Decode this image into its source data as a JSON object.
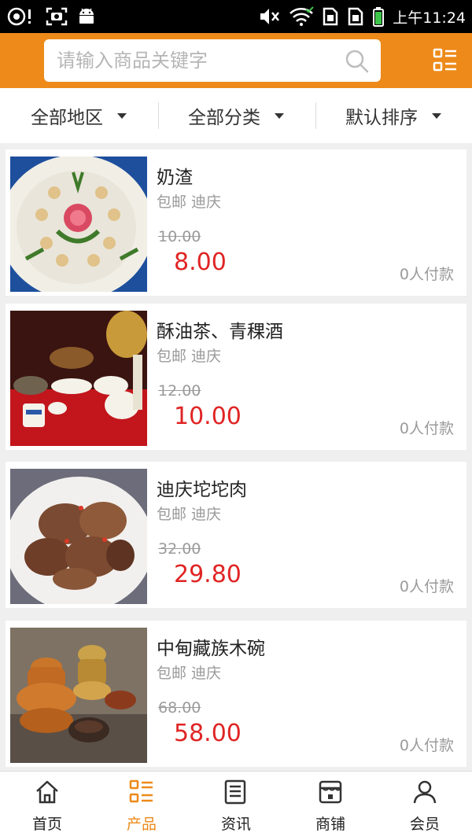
{
  "status_bar": {
    "time": "上午11:24"
  },
  "header": {
    "search_placeholder": "请输入商品关键字",
    "accent_color": "#ed8a19"
  },
  "filters": [
    {
      "label": "全部地区"
    },
    {
      "label": "全部分类"
    },
    {
      "label": "默认排序"
    }
  ],
  "products": [
    {
      "name": "奶渣",
      "tags": "包邮 迪庆",
      "original_price": "10.00",
      "price": "8.00",
      "sold": "0人付款"
    },
    {
      "name": "酥油茶、青稞酒",
      "tags": "包邮 迪庆",
      "original_price": "12.00",
      "price": "10.00",
      "sold": "0人付款"
    },
    {
      "name": "迪庆坨坨肉",
      "tags": "包邮 迪庆",
      "original_price": "32.00",
      "price": "29.80",
      "sold": "0人付款"
    },
    {
      "name": "中甸藏族木碗",
      "tags": "包邮 迪庆",
      "original_price": "68.00",
      "price": "58.00",
      "sold": "0人付款"
    }
  ],
  "tabs": [
    {
      "label": "首页",
      "icon": "home-icon"
    },
    {
      "label": "产品",
      "icon": "list-icon",
      "active": true
    },
    {
      "label": "资讯",
      "icon": "news-icon"
    },
    {
      "label": "商铺",
      "icon": "shop-icon"
    },
    {
      "label": "会员",
      "icon": "user-icon"
    }
  ]
}
